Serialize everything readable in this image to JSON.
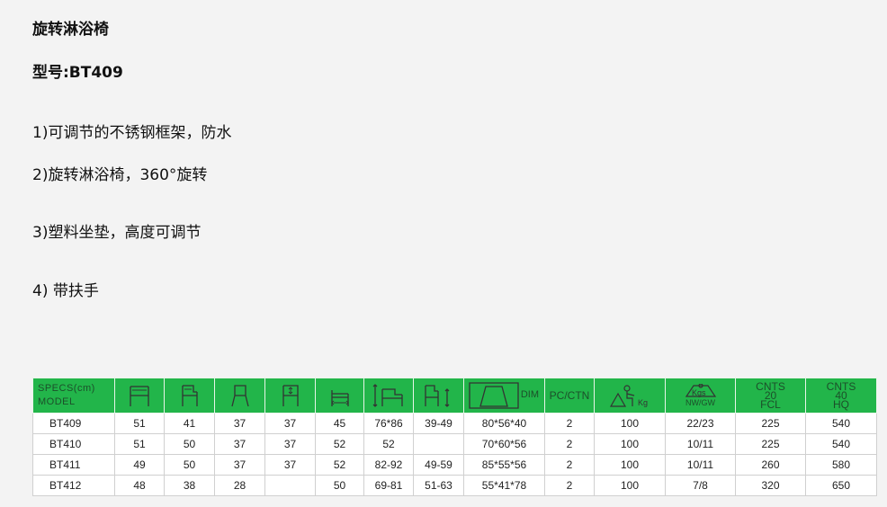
{
  "title": "旋转淋浴椅",
  "model_line": "型号:BT409",
  "features": [
    "1)可调节的不锈钢框架，防水",
    "2)旋转淋浴椅，360°旋转",
    "3)塑料坐垫，高度可调节",
    "4) 带扶手"
  ],
  "table": {
    "header_specs": "SPECS(cm)",
    "header_model": "MODEL",
    "dim_label": "DIM",
    "pcctn_label": "PC/CTN",
    "kg_label": "Kg",
    "kgs_label": "Kgs",
    "nwgw_label": "NW/GW",
    "cnts20": [
      "CNTS",
      "20",
      "FCL"
    ],
    "cnts40": [
      "CNTS",
      "40",
      "HQ"
    ],
    "header_color": "#22b54a",
    "rows": [
      [
        "BT409",
        "51",
        "41",
        "37",
        "37",
        "45",
        "76*86",
        "39-49",
        "80*56*40",
        "2",
        "100",
        "22/23",
        "225",
        "540"
      ],
      [
        "BT410",
        "51",
        "50",
        "37",
        "37",
        "52",
        "52",
        "",
        "70*60*56",
        "2",
        "100",
        "10/11",
        "225",
        "540"
      ],
      [
        "BT411",
        "49",
        "50",
        "37",
        "37",
        "52",
        "82-92",
        "49-59",
        "85*55*56",
        "2",
        "100",
        "10/11",
        "260",
        "580"
      ],
      [
        "BT412",
        "48",
        "38",
        "28",
        "",
        "50",
        "69-81",
        "51-63",
        "55*41*78",
        "2",
        "100",
        "7/8",
        "320",
        "650"
      ]
    ]
  }
}
